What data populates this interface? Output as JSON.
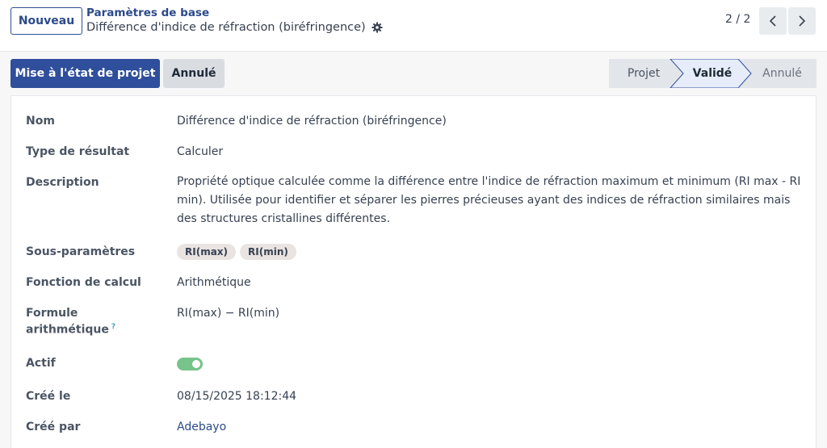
{
  "header": {
    "new_label": "Nouveau",
    "breadcrumb_parent": "Paramètres de base",
    "breadcrumb_current": "Différence d'indice de réfraction (biréfringence)",
    "pager": "2 / 2"
  },
  "actions": {
    "primary_label": "Mise à l'état de projet",
    "secondary_label": "Annulé"
  },
  "statusbar": {
    "stages": [
      {
        "label": "Projet",
        "active": false
      },
      {
        "label": "Validé",
        "active": true
      },
      {
        "label": "Annulé",
        "active": false
      }
    ]
  },
  "form": {
    "name_label": "Nom",
    "name_value": "Différence d'indice de réfraction (biréfringence)",
    "result_type_label": "Type de résultat",
    "result_type_value": "Calculer",
    "description_label": "Description",
    "description_value": "Propriété optique calculée comme la différence entre l'indice de réfraction maximum et minimum (RI max - RI min). Utilisée pour identifier et séparer les pierres précieuses ayant des indices de réfraction similaires mais des structures cristallines différentes.",
    "subparams_label": "Sous-paramètres",
    "subparams": [
      "RI(max)",
      "RI(min)"
    ],
    "calc_function_label": "Fonction de calcul",
    "calc_function_value": "Arithmétique",
    "formula_label_line1": "Formule",
    "formula_label_line2": "arithmétique",
    "formula_help": "?",
    "formula_value": "RI(max) − RI(min)",
    "active_label": "Actif",
    "active_value": true,
    "created_on_label": "Créé le",
    "created_on_value": "08/15/2025 18:12:44",
    "created_by_label": "Créé par",
    "created_by_value": "Adebayo"
  },
  "colors": {
    "primary": "#2f4e9b",
    "link": "#2b4a8a",
    "toggle_on": "#76c48a",
    "stage_active_bg": "#e6ecf9"
  }
}
